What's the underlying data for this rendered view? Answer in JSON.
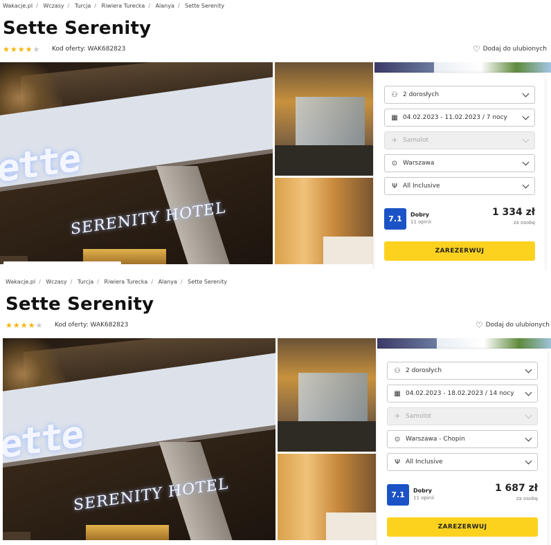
{
  "breadcrumb": [
    "Wakacje.pl",
    "Wczasy",
    "Turcja",
    "Riwiera Turecka",
    "Alanya",
    "Sette Serenity"
  ],
  "hotel": {
    "name": "Sette Serenity",
    "stars_filled": 4,
    "stars_total": 5,
    "offer_code": "Kod oferty: WAK682823",
    "favorite_label": "Dodaj do ulubionych"
  },
  "photo_sign": {
    "big": "ette",
    "small": "SERENITY HOTEL"
  },
  "offers": [
    {
      "travelers": "2 dorosłych",
      "dates": "04.02.2023 - 11.02.2023 / 7 nocy",
      "transport": "Samolot",
      "departure": "Warszawa",
      "board": "All Inclusive",
      "rating_score": "7.1",
      "rating_label": "Dobry",
      "rating_count": "11 opinii",
      "price": "1 334 zł",
      "price_note": "za osobę",
      "reserve_label": "ZAREZERWUJ"
    },
    {
      "travelers": "2 dorosłych",
      "dates": "04.02.2023 - 18.02.2023 / 14 nocy",
      "transport": "Samolot",
      "departure": "Warszawa - Chopin",
      "board": "All Inclusive",
      "rating_score": "7.1",
      "rating_label": "Dobry",
      "rating_count": "11 opinii",
      "price": "1 687 zł",
      "price_note": "za osobę",
      "reserve_label": "ZAREZERWUJ"
    }
  ],
  "icons": {
    "person": "person-icon",
    "calendar": "calendar-icon",
    "plane": "plane-icon",
    "location": "location-pin-icon",
    "food": "cutlery-icon",
    "heart": "heart-icon",
    "chevron": "chevron-down-icon"
  },
  "colors": {
    "accent_yellow": "#fcd21f",
    "rating_blue": "#1b53c6",
    "star_gold": "#f5b400"
  }
}
